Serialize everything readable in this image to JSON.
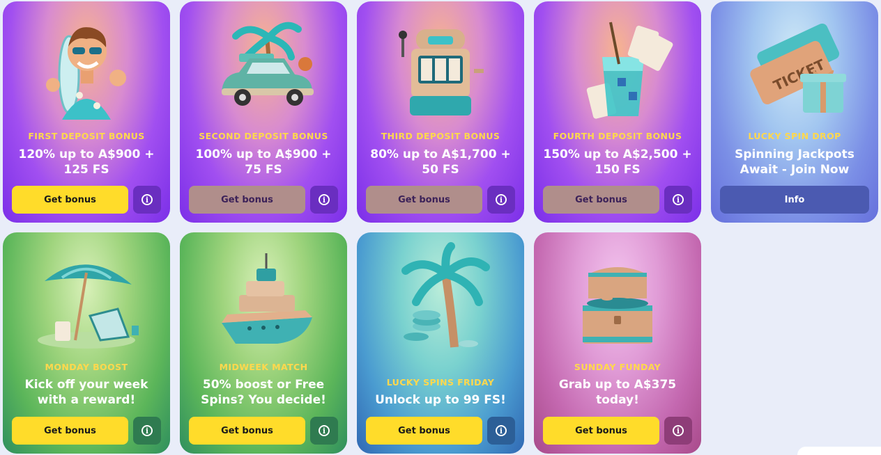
{
  "cards": [
    {
      "tag": "FIRST DEPOSIT BONUS",
      "title": "120% up to A$900 + 125 FS",
      "button": "Get bonus",
      "icon": "surfer-man-icon"
    },
    {
      "tag": "SECOND DEPOSIT BONUS",
      "title": "100% up to A$900 + 75 FS",
      "button": "Get bonus",
      "icon": "vintage-car-icon"
    },
    {
      "tag": "THIRD DEPOSIT BONUS",
      "title": "80% up to A$1,700 + 50 FS",
      "button": "Get bonus",
      "icon": "slot-machine-icon"
    },
    {
      "tag": "FOURTH DEPOSIT BONUS",
      "title": "150% up to A$2,500 + 150 FS",
      "button": "Get bonus",
      "icon": "cocktail-cards-icon"
    },
    {
      "tag": "LUCKY SPIN DROP",
      "title": "Spinning Jackpots Await - Join Now",
      "button": "Info",
      "icon": "ticket-gift-icon"
    },
    {
      "tag": "MONDAY BOOST",
      "title": "Kick off your week with a reward!",
      "button": "Get bonus",
      "icon": "beach-umbrella-icon"
    },
    {
      "tag": "MIDWEEK MATCH",
      "title": "50% boost or Free Spins? You decide!",
      "button": "Get bonus",
      "icon": "yacht-icon"
    },
    {
      "tag": "LUCKY SPINS FRIDAY",
      "title": "Unlock up to 99 FS!",
      "button": "Get bonus",
      "icon": "palm-tree-chips-icon"
    },
    {
      "tag": "SUNDAY FUNDAY",
      "title": "Grab up to A$375 today!",
      "button": "Get bonus",
      "icon": "treasure-chest-icon"
    }
  ],
  "info_glyph": "i",
  "colors": {
    "purple": "#8a3df0",
    "blue": "#6f7fe0",
    "green": "#3ea363",
    "ocean": "#3b78c0",
    "pink": "#b44f94",
    "yellow_button": "#ffdc2a",
    "muted_button": "#b08e8b",
    "tag_yellow": "#ffd84d"
  }
}
